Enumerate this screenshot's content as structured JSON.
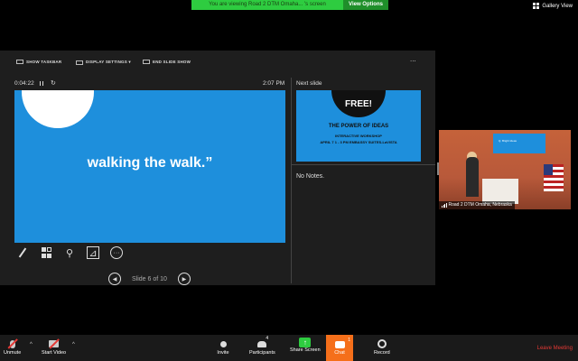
{
  "banner": {
    "message": "You are viewing Road 2 DTM Omaha... 's screen",
    "view_options": "View Options"
  },
  "gallery_view": {
    "label": "Gallery View",
    "icon": "gallery-grid-icon"
  },
  "presenter_view": {
    "toolbar": {
      "show_taskbar": "SHOW TASKBAR",
      "display_settings": "DISPLAY SETTINGS ▾",
      "end_slide_show": "END SLIDE SHOW",
      "more": "..."
    },
    "timer": "0:04:22",
    "clock": "2:07 PM",
    "current_slide": {
      "quote_mark": "“",
      "text": "walking the walk.”"
    },
    "slide_counter": "Slide 6 of 10",
    "next_label": "Next slide",
    "next_slide": {
      "top_line": "",
      "free": "FREE!",
      "headline": "THE POWER OF IDEAS",
      "subhead": "INTERACTIVE WORKSHOP",
      "details": "APRIL 7   1 - 3 PM   EMBASSY SUITES-LaVISTA"
    },
    "notes": "No Notes."
  },
  "video_tile": {
    "name": "Road 2 DTM Omaha, Nebraska",
    "screen_text": "Q. Bright Ideas"
  },
  "controls": {
    "unmute": "Unmute",
    "start_video": "Start Video",
    "invite": "Invite",
    "participants": "Participants",
    "participant_count": "4",
    "share_screen": "Share Screen",
    "chat": "Chat",
    "chat_badge": "1",
    "record": "Record",
    "leave_meeting": "Leave Meeting"
  },
  "colors": {
    "banner_green": "#2ecc40",
    "slide_blue": "#1e8fdc",
    "chat_orange": "#f56f1a",
    "leave_red": "#e53935"
  }
}
